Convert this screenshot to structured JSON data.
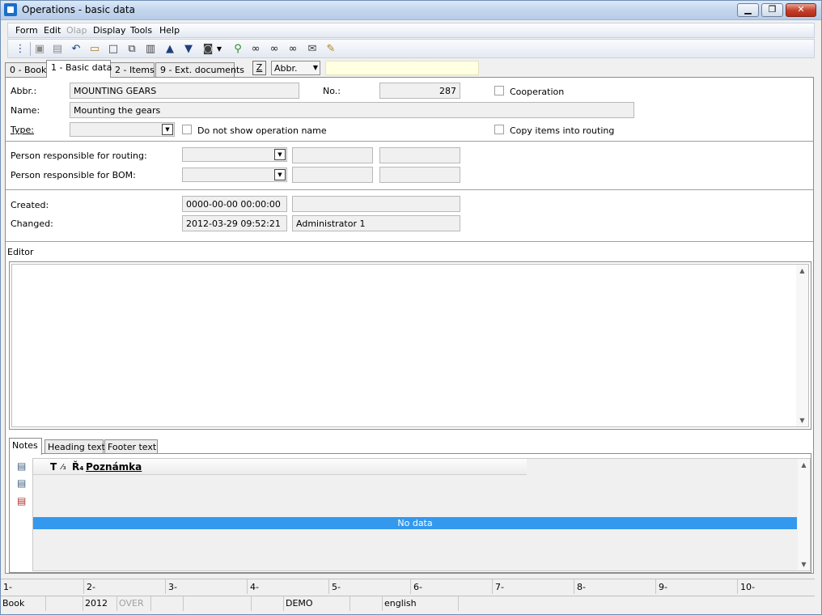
{
  "window": {
    "title": "Operations - basic data",
    "min_label": "▁",
    "max_label": "❐",
    "close_label": "✕"
  },
  "menu": [
    "Form",
    "Edit",
    "Olap",
    "Display",
    "Tools",
    "Help"
  ],
  "toolbar_icons": [
    "tree-icon",
    "save-icon",
    "save-as-icon",
    "undo-icon",
    "open-folder-icon",
    "new-document-icon",
    "copy-icon",
    "book-icon",
    "up-arrow-icon",
    "down-arrow-icon",
    "camera-icon",
    "dropdown-icon",
    "filter-icon",
    "binoculars-icon",
    "binoculars-next-icon",
    "binoculars-prev-icon",
    "mail-icon",
    "notes-icon"
  ],
  "tabs": [
    "0 - Book",
    "1 - Basic data",
    "2 - Items",
    "9 - Ext. documents"
  ],
  "z_button": "Z",
  "abbr_select": "Abbr.",
  "form": {
    "abbr_label": "Abbr.:",
    "abbr_value": "MOUNTING GEARS",
    "no_label": "No.:",
    "no_value": "287",
    "cooperation_label": "Cooperation",
    "name_label": "Name:",
    "name_value": "Mounting the gears",
    "type_label": "Type:",
    "type_value": "",
    "hide_name_label": "Do not show operation name",
    "copy_items_label": "Copy items into routing",
    "routing_person_label": "Person responsible for routing:",
    "bom_person_label": "Person responsible for BOM:",
    "created_label": "Created:",
    "created_value": "0000-00-00 00:00:00",
    "created_by": "",
    "changed_label": "Changed:",
    "changed_value": "2012-03-29 09:52:21",
    "changed_by": "Administrator 1",
    "editor_label": "Editor"
  },
  "notes_tabs": [
    "Notes",
    "Heading text",
    "Footer text"
  ],
  "grid": {
    "headers": [
      "T",
      "⁄₃",
      "Ř₄",
      "Poznámka"
    ],
    "no_data": "No data"
  },
  "ruler": [
    "1-",
    "2-",
    "3-",
    "4-",
    "5-",
    "6-",
    "7-",
    "8-",
    "9-",
    "10-"
  ],
  "status": {
    "book": "Book",
    "year": "2012",
    "mode": "OVER",
    "db": "DEMO",
    "language": "english"
  },
  "colors": {
    "nodata_row": "#3399ee",
    "search_bg": "#ffffe1",
    "close_button": "#c5432d"
  }
}
